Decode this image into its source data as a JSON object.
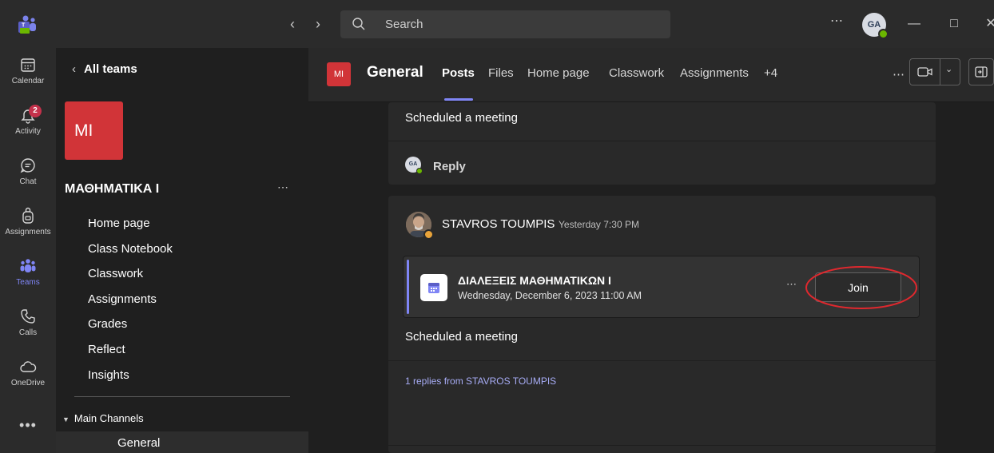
{
  "topbar": {
    "search_placeholder": "Search",
    "more_label": "⋯",
    "avatar_initials": "GA",
    "back_arrow": "‹",
    "forward_arrow": "›",
    "minimize": "—",
    "maximize": "□",
    "close": "✕"
  },
  "rail": {
    "items": [
      {
        "label": "Calendar",
        "icon": "calendar-icon"
      },
      {
        "label": "Activity",
        "icon": "bell-icon",
        "badge": "2"
      },
      {
        "label": "Chat",
        "icon": "chat-icon"
      },
      {
        "label": "Assignments",
        "icon": "backpack-icon"
      },
      {
        "label": "Teams",
        "icon": "teams-icon",
        "active": true
      },
      {
        "label": "Calls",
        "icon": "phone-icon"
      },
      {
        "label": "OneDrive",
        "icon": "cloud-icon"
      }
    ],
    "more_label": "•••"
  },
  "teampane": {
    "back_label": "All teams",
    "team_initials": "MI",
    "team_name": "ΜΑΘΗΜΑΤΙΚΑ Ι",
    "team_more": "⋯",
    "nav": [
      "Home page",
      "Class Notebook",
      "Classwork",
      "Assignments",
      "Grades",
      "Reflect",
      "Insights"
    ],
    "channels_header": "Main Channels",
    "current_channel": "General"
  },
  "channel_header": {
    "avatar_initials": "MI",
    "title": "General",
    "tabs": [
      "Posts",
      "Files",
      "Home page",
      "Classwork",
      "Assignments",
      "+4"
    ],
    "active_tab": "Posts",
    "more_label": "⋯"
  },
  "posts": {
    "first": {
      "text": "Scheduled a meeting",
      "reply_avatar": "GA",
      "reply_label": "Reply"
    },
    "second": {
      "author": "STAVROS TOUMPIS",
      "time": "Yesterday 7:30 PM",
      "meeting": {
        "title": "ΔΙΑΛΕΞΕΙΣ ΜΑΘΗΜΑΤΙΚΩΝ Ι",
        "date": "Wednesday, December 6, 2023 11:00 AM",
        "more_label": "⋯",
        "join_label": "Join"
      },
      "text": "Scheduled a meeting",
      "replies_link": "1 replies from STAVROS TOUMPIS"
    }
  },
  "colors": {
    "accent": "#7f85f5",
    "team_tile": "#d13438",
    "highlight_oval": "#e0282e",
    "presence_available": "#6bb700",
    "presence_away": "#e8a33a"
  }
}
